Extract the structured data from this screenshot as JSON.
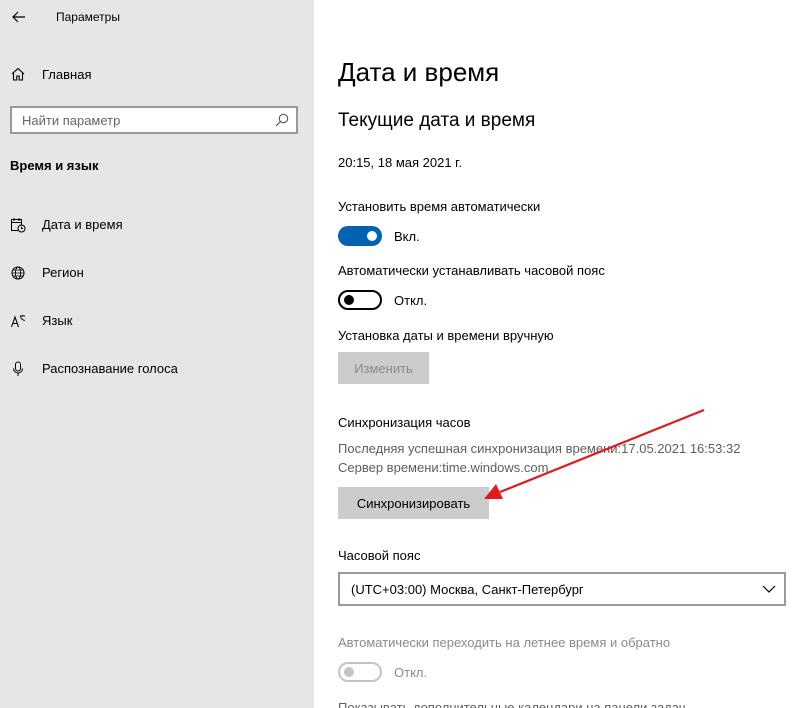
{
  "window": {
    "title": "Параметры"
  },
  "sidebar": {
    "home_label": "Главная",
    "search_placeholder": "Найти параметр",
    "section_title": "Время и язык",
    "items": [
      {
        "label": "Дата и время",
        "icon": "calendar-clock-icon"
      },
      {
        "label": "Регион",
        "icon": "globe-icon"
      },
      {
        "label": "Язык",
        "icon": "language-icon"
      },
      {
        "label": "Распознавание голоса",
        "icon": "microphone-icon"
      }
    ]
  },
  "main": {
    "title": "Дата и время",
    "subheading": "Текущие дата и время",
    "current_datetime": "20:15, 18 мая 2021 г.",
    "auto_time": {
      "label": "Установить время автоматически",
      "state": "Вкл.",
      "on": true
    },
    "auto_timezone": {
      "label": "Автоматически устанавливать часовой пояс",
      "state": "Откл.",
      "on": false
    },
    "manual": {
      "label": "Установка даты и времени вручную",
      "button": "Изменить"
    },
    "sync": {
      "title": "Синхронизация часов",
      "last_sync": "Последняя успешная синхронизация времени:17.05.2021 16:53:32",
      "server": "Сервер времени:time.windows.com",
      "button": "Синхронизировать"
    },
    "timezone": {
      "label": "Часовой пояс",
      "value": "(UTC+03:00) Москва, Санкт-Петербург"
    },
    "dst": {
      "label": "Автоматически переходить на летнее время и обратно",
      "state": "Откл."
    },
    "cut_off_text": "Показывать дополнительные календари на панели задач"
  },
  "colors": {
    "accent": "#0063b1",
    "sidebar_bg": "#e6e6e6",
    "annotation_arrow": "#e01b1b"
  }
}
